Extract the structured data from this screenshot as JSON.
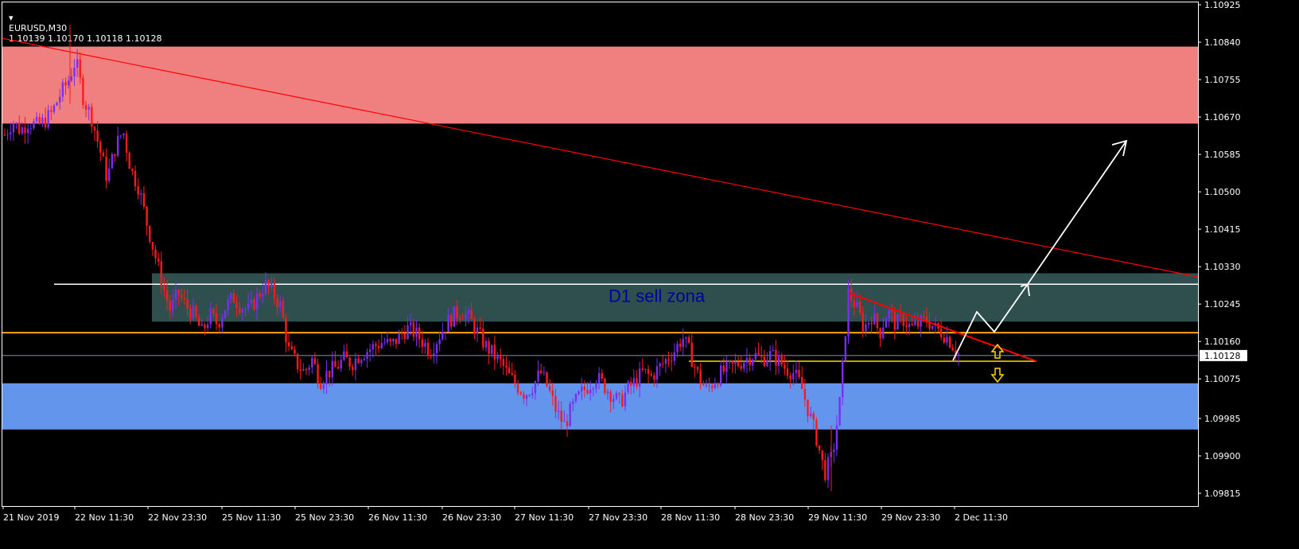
{
  "header": {
    "symbol": "EURUSD,M30",
    "quotes": "1.10139 1.10170 1.10118 1.10128"
  },
  "colors": {
    "background": "#000000",
    "axis": "#ffffff",
    "bull_candle": "#7a2df5",
    "bear_candle": "#ff1a1a",
    "sell_zone_top": "#f08080",
    "sell_zone_d1": "#2f4f4f",
    "buy_zone": "#6495ed",
    "trendline": "#ff0000",
    "orange_line": "#ffa500",
    "yellow_line": "#ffd700",
    "white_line": "#ffffff",
    "current_price_line": "#b0c4de"
  },
  "chart_data": {
    "type": "candlestick",
    "symbol": "EURUSD",
    "timeframe": "M30",
    "current_price": "1.10128",
    "price_ticks": [
      "1.10925",
      "1.10840",
      "1.10755",
      "1.10670",
      "1.10585",
      "1.10500",
      "1.10415",
      "1.10330",
      "1.10245",
      "1.10160",
      "1.10075",
      "1.09985",
      "1.09900",
      "1.09815"
    ],
    "time_ticks": [
      "21 Nov 2019",
      "22 Nov 11:30",
      "22 Nov 23:30",
      "25 Nov 11:30",
      "25 Nov 23:30",
      "26 Nov 11:30",
      "26 Nov 23:30",
      "27 Nov 11:30",
      "27 Nov 23:30",
      "28 Nov 11:30",
      "28 Nov 23:30",
      "29 Nov 11:30",
      "29 Nov 23:30",
      "2 Dec 11:30"
    ],
    "zones": [
      {
        "name": "upper-sell-zone",
        "price_top": 1.1083,
        "price_bottom": 1.10655
      },
      {
        "name": "d1-sell-zone",
        "label": "D1 sell zona",
        "price_top": 1.10315,
        "price_bottom": 1.10205
      },
      {
        "name": "buy-zone",
        "price_top": 1.10065,
        "price_bottom": 1.0996
      }
    ],
    "horizontal_lines": [
      {
        "name": "white-level",
        "price": 1.1029
      },
      {
        "name": "orange-level",
        "price": 1.1018
      },
      {
        "name": "yellow-level",
        "price": 1.10115
      },
      {
        "name": "current-price",
        "price": 1.10128
      }
    ],
    "candles_hint": "price path approximated from the screenshot",
    "price_path": [
      1.1063,
      1.1066,
      1.1064,
      1.1066,
      1.1065,
      1.1066,
      1.1068,
      1.1072,
      1.1075,
      1.108,
      1.1071,
      1.1067,
      1.106,
      1.1053,
      1.106,
      1.1064,
      1.1055,
      1.1051,
      1.1043,
      1.1036,
      1.1029,
      1.1023,
      1.1027,
      1.1024,
      1.1022,
      1.1018,
      1.1022,
      1.102,
      1.1024,
      1.1026,
      1.1024,
      1.1023,
      1.1026,
      1.1029,
      1.1027,
      1.1024,
      1.1014,
      1.1011,
      1.1009,
      1.1012,
      1.1007,
      1.1009,
      1.101,
      1.1012,
      1.1011,
      1.1013,
      1.1014,
      1.1015,
      1.1016,
      1.1015,
      1.1017,
      1.1019,
      1.1018,
      1.1016,
      1.1014,
      1.1017,
      1.102,
      1.1022,
      1.1023,
      1.1021,
      1.1018,
      1.1015,
      1.1013,
      1.1011,
      1.1008,
      1.1006,
      1.1004,
      1.1006,
      1.1009,
      1.1005,
      1.1,
      1.0997,
      1.1001,
      1.1004,
      1.1006,
      1.1008,
      1.1006,
      1.1004,
      1.1002,
      1.1005,
      1.1007,
      1.1009,
      1.1008,
      1.101,
      1.1012,
      1.1014,
      1.1017,
      1.1013,
      1.1008,
      1.1005,
      1.1007,
      1.1009,
      1.101,
      1.1011,
      1.1012,
      1.1013,
      1.1012,
      1.1013,
      1.1012,
      1.101,
      1.1009,
      1.1006,
      1.1,
      1.0994,
      1.0986,
      1.099,
      1.1003,
      1.1027,
      1.1024,
      1.1019,
      1.1022,
      1.1018,
      1.1023,
      1.102,
      1.1021,
      1.1019,
      1.102,
      1.1021,
      1.1019,
      1.1018,
      1.1016,
      1.1013
    ]
  },
  "annotations": {
    "zone_label": "D1 sell zona"
  }
}
